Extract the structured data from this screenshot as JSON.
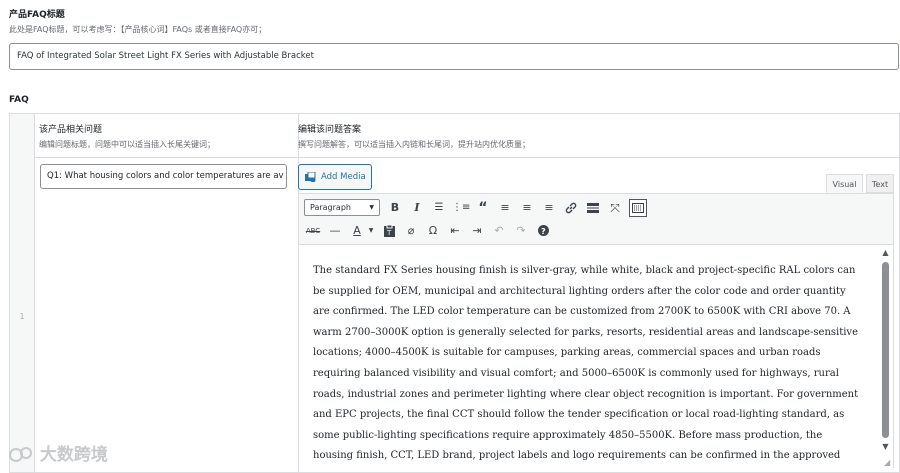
{
  "title_section": {
    "label": "产品FAQ标题",
    "hint": "此处是FAQ标题，可以考虑写：【产品核心词】FAQs 或者直接FAQ亦可；",
    "value": "FAQ of Integrated Solar Street Light FX Series with Adjustable Bracket"
  },
  "faq_section": {
    "label": "FAQ",
    "col_question_title": "该产品相关问题",
    "col_question_hint": "编辑问题标题，问题中可以适当插入长尾关键词；",
    "col_answer_title": "编辑该问题答案",
    "col_answer_hint": "撰写问题解答，可以适当插入内链和长尾词，提升站内优化质量；",
    "row_number": "1",
    "question_value": "Q1: What housing colors and color temperatures are av"
  },
  "editor": {
    "add_media_label": "Add Media",
    "tab_visual": "Visual",
    "tab_text": "Text",
    "format_select": "Paragraph",
    "icons_row1": [
      "bold-icon",
      "italic-icon",
      "bullet-list-icon",
      "numbered-list-icon",
      "blockquote-icon",
      "align-left-icon",
      "align-center-icon",
      "align-right-icon",
      "link-icon",
      "read-more-icon",
      "fullscreen-icon",
      "toolbar-toggle-icon"
    ],
    "icons_row2": [
      "strikethrough-icon",
      "horizontal-line-icon",
      "text-color-icon",
      "paste-text-icon",
      "clear-formatting-icon",
      "special-character-icon",
      "outdent-icon",
      "indent-icon",
      "undo-icon",
      "redo-icon",
      "help-icon"
    ],
    "content": "The standard FX Series housing finish is silver-gray, while white, black and project-specific RAL colors can be supplied for OEM, municipal and architectural lighting orders after the color code and order quantity are confirmed. The LED color temperature can be customized from 2700K to 6500K with CRI above 70. A warm 2700–3000K option is generally selected for parks, resorts, residential areas and landscape-sensitive locations; 4000–4500K is suitable for campuses, parking areas, commercial spaces and urban roads requiring balanced visibility and visual comfort; and 5000–6500K is commonly used for highways, rural roads, industrial zones and perimeter lighting where clear object recognition is important. For government and EPC projects, the final CCT should follow the tender specification or local road-lighting standard, as some public-lighting specifications require approximately 4850–5500K. Before mass production, the housing finish, CCT, LED brand, project labels and logo requirements can be confirmed in the approved order specification to maintain consistent"
  },
  "watermark": {
    "text": "大数跨境"
  },
  "colors": {
    "accent": "#2271b1",
    "border": "#dcdcde",
    "toolbar_bg": "#f6f7f7"
  }
}
